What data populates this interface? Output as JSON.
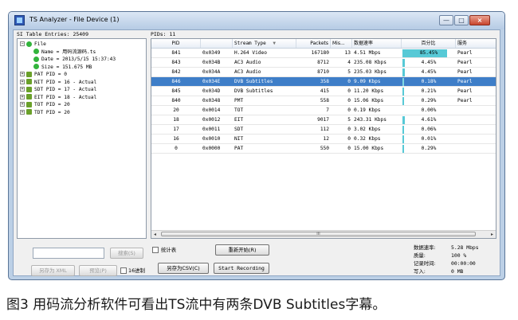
{
  "window": {
    "title": "TS Analyzer - File Device (1)",
    "controls": [
      "—",
      "□",
      "×"
    ]
  },
  "left_panel": {
    "header": "SI Table Entries: 25409",
    "tree": [
      {
        "label": "File",
        "expander": "−",
        "icon": "green-dot",
        "level": 0
      },
      {
        "label": "Name = 用码流源码.ts",
        "expander": "",
        "icon": "green-dot",
        "level": 1
      },
      {
        "label": "Date = 2013/5/15 15:37:43",
        "expander": "",
        "icon": "green-dot",
        "level": 1
      },
      {
        "label": "Size = 151.675 MB",
        "expander": "",
        "icon": "green-dot",
        "level": 1
      },
      {
        "label": "PAT PID = 0",
        "expander": "+",
        "icon": "table-icon",
        "level": 0
      },
      {
        "label": "NIT PID = 16 - Actual",
        "expander": "+",
        "icon": "table-icon",
        "level": 0
      },
      {
        "label": "SDT PID = 17 - Actual",
        "expander": "+",
        "icon": "table-icon",
        "level": 0
      },
      {
        "label": "EIT PID = 18 - Actual",
        "expander": "+",
        "icon": "table-icon",
        "level": 0
      },
      {
        "label": "TOT PID = 20",
        "expander": "+",
        "icon": "table-icon",
        "level": 0
      },
      {
        "label": "TDT PID = 20",
        "expander": "+",
        "icon": "table-icon",
        "level": 0
      }
    ],
    "search_button": "搜索(S)",
    "save_xml_button": "另存为 XML",
    "preview_button": "预览(P)",
    "hex_checkbox_label": "16进制"
  },
  "right_panel": {
    "header": "PIDs: 11",
    "columns": [
      "PID",
      "",
      "Stream Type",
      "Packets",
      "Mis...",
      "数据速率",
      "百分比",
      "服务"
    ],
    "sort_indicator": "▼",
    "selected_row_index": 3,
    "rows": [
      {
        "pid": "841",
        "hex": "0x0349",
        "type": "H.264 Video",
        "packets": "167180",
        "mis": "13",
        "rate": "4.51 Mbps",
        "pct": "85.45%",
        "pct_value": 85.45,
        "service": "Pearl"
      },
      {
        "pid": "843",
        "hex": "0x034B",
        "type": "AC3 Audio",
        "packets": "8712",
        "mis": "4",
        "rate": "235.08 Kbps",
        "pct": "4.45%",
        "pct_value": 4.45,
        "service": "Pearl"
      },
      {
        "pid": "842",
        "hex": "0x034A",
        "type": "AC3 Audio",
        "packets": "8710",
        "mis": "5",
        "rate": "235.03 Kbps",
        "pct": "4.45%",
        "pct_value": 4.45,
        "service": "Pearl"
      },
      {
        "pid": "846",
        "hex": "0x034E",
        "type": "DVB Subtitles",
        "packets": "358",
        "mis": "0",
        "rate": "9.09 Kbps",
        "pct": "0.18%",
        "pct_value": 0.18,
        "service": "Pearl"
      },
      {
        "pid": "845",
        "hex": "0x034D",
        "type": "DVB Subtitles",
        "packets": "415",
        "mis": "0",
        "rate": "11.20 Kbps",
        "pct": "0.21%",
        "pct_value": 0.21,
        "service": "Pearl"
      },
      {
        "pid": "840",
        "hex": "0x0348",
        "type": "PMT",
        "packets": "558",
        "mis": "0",
        "rate": "15.06 Kbps",
        "pct": "0.29%",
        "pct_value": 0.29,
        "service": "Pearl"
      },
      {
        "pid": "20",
        "hex": "0x0014",
        "type": "TOT",
        "packets": "7",
        "mis": "0",
        "rate": "0.19 Kbps",
        "pct": "0.00%",
        "pct_value": 0.0,
        "service": ""
      },
      {
        "pid": "18",
        "hex": "0x0012",
        "type": "EIT",
        "packets": "9017",
        "mis": "5",
        "rate": "243.31 Kbps",
        "pct": "4.61%",
        "pct_value": 4.61,
        "service": ""
      },
      {
        "pid": "17",
        "hex": "0x0011",
        "type": "SDT",
        "packets": "112",
        "mis": "0",
        "rate": "3.02 Kbps",
        "pct": "0.06%",
        "pct_value": 0.06,
        "service": ""
      },
      {
        "pid": "16",
        "hex": "0x0010",
        "type": "NIT",
        "packets": "12",
        "mis": "0",
        "rate": "0.32 Kbps",
        "pct": "0.01%",
        "pct_value": 0.01,
        "service": ""
      },
      {
        "pid": "0",
        "hex": "0x0000",
        "type": "PAT",
        "packets": "550",
        "mis": "0",
        "rate": "15.00 Kbps",
        "pct": "0.29%",
        "pct_value": 0.29,
        "service": ""
      }
    ],
    "scroll_thumb_label": "III",
    "scroll_left": "◂",
    "scroll_right": "▸",
    "stats_checkbox_label": "统计表",
    "restart_button": "重新开始(R)",
    "save_csv_button": "另存为CSV(C)",
    "start_recording_button": "Start Recording",
    "stats": {
      "rate_label": "数据速率:",
      "rate_value": "5.28 Mbps",
      "quality_label": "质量:",
      "quality_value": "100 %",
      "rec_time_label": "记录时间:",
      "rec_time_value": "00:00:00",
      "write_label": "写入:",
      "write_value": "0 MB"
    }
  },
  "caption": "图3 用码流分析软件可看出TS流中有两条DVB Subtitles字幕。",
  "colors": {
    "selection": "#3e7ec8",
    "percent_bar": "#57c9d6",
    "tree_icon": "#32b43c"
  }
}
